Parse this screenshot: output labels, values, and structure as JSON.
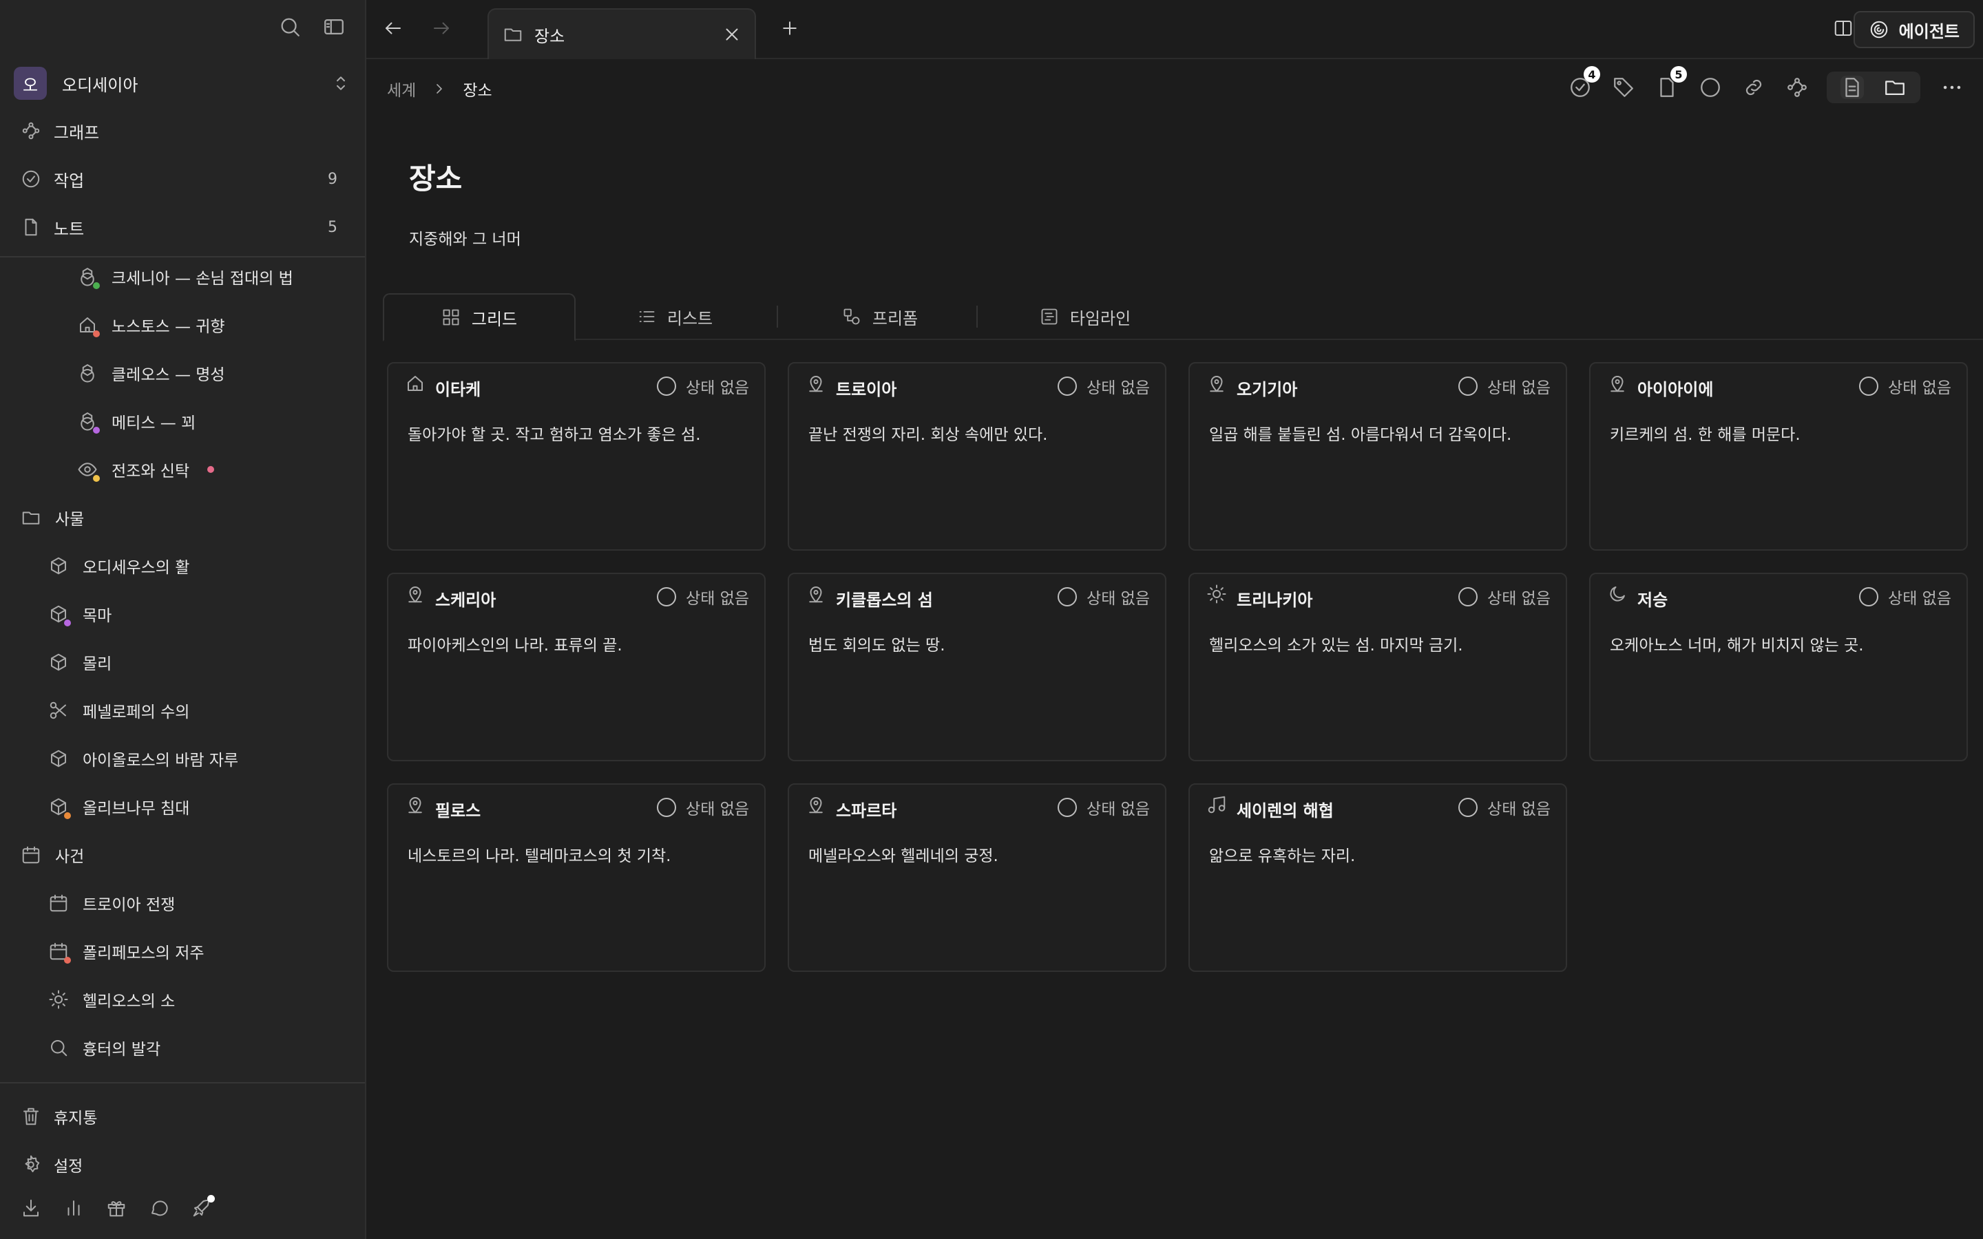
{
  "sidebar": {
    "workspace": {
      "initial": "오",
      "name": "오디세이아"
    },
    "nav": [
      {
        "label": "그래프",
        "icon": "graph-icon",
        "count": ""
      },
      {
        "label": "작업",
        "icon": "task-check-icon",
        "count": "9"
      },
      {
        "label": "노트",
        "icon": "note-icon",
        "count": "5"
      }
    ],
    "tree": [
      {
        "label": "크세니아 — 손님 접대의 법",
        "icon": "globe-icon",
        "dot": "#4caf50"
      },
      {
        "label": "노스토스 — 귀향",
        "icon": "home-icon",
        "dot": "#e66a5a"
      },
      {
        "label": "클레오스 — 명성",
        "icon": "globe-icon",
        "dot": ""
      },
      {
        "label": "메티스 — 꾀",
        "icon": "globe-icon",
        "dot": "#b667e0"
      },
      {
        "label": "전조와 신탁",
        "icon": "eye-icon",
        "dot": "#f0c24a",
        "inline_dot": "#e56b8a"
      },
      {
        "label": "사물",
        "icon": "folder-icon",
        "dot": ""
      },
      {
        "label": "오디세우스의 활",
        "icon": "cube-icon",
        "dot": ""
      },
      {
        "label": "목마",
        "icon": "cube-icon",
        "dot": "#b667e0"
      },
      {
        "label": "몰리",
        "icon": "cube-icon",
        "dot": ""
      },
      {
        "label": "페넬로페의 수의",
        "icon": "scissors-icon",
        "dot": ""
      },
      {
        "label": "아이올로스의 바람 자루",
        "icon": "cube-icon",
        "dot": ""
      },
      {
        "label": "올리브나무 침대",
        "icon": "cube-icon",
        "dot": "#e88a3a"
      },
      {
        "label": "사건",
        "icon": "calendar-icon",
        "dot": ""
      },
      {
        "label": "트로이아 전쟁",
        "icon": "calendar-icon",
        "dot": ""
      },
      {
        "label": "폴리페모스의 저주",
        "icon": "calendar-icon",
        "dot": "#e66a5a"
      },
      {
        "label": "헬리오스의 소",
        "icon": "sun-icon",
        "dot": ""
      },
      {
        "label": "흉터의 발각",
        "icon": "search-icon",
        "dot": ""
      }
    ],
    "trash": "휴지통",
    "settings": "설정"
  },
  "tabs": [
    {
      "label": "장소",
      "icon": "folder-icon"
    }
  ],
  "agent_label": "에이전트",
  "breadcrumb": {
    "parent": "세계",
    "current": "장소"
  },
  "toolbar": {
    "tasks_badge": "4",
    "notes_badge": "5"
  },
  "page": {
    "title": "장소",
    "description": "지중해와 그 너머"
  },
  "view_tabs": [
    {
      "label": "그리드",
      "icon": "grid-icon",
      "active": true
    },
    {
      "label": "리스트",
      "icon": "list-icon",
      "active": false
    },
    {
      "label": "프리폼",
      "icon": "freeform-icon",
      "active": false
    },
    {
      "label": "타임라인",
      "icon": "timeline-icon",
      "active": false
    }
  ],
  "cards": [
    {
      "title": "이타케",
      "icon": "home-icon",
      "status": "상태 없음",
      "desc": "돌아가야 할 곳. 작고 험하고 염소가 좋은 섬."
    },
    {
      "title": "트로이아",
      "icon": "location-pin-icon",
      "status": "상태 없음",
      "desc": "끝난 전쟁의 자리. 회상 속에만 있다."
    },
    {
      "title": "오기기아",
      "icon": "location-pin-icon",
      "status": "상태 없음",
      "desc": "일곱 해를 붙들린 섬. 아름다워서 더 감옥이다."
    },
    {
      "title": "아이아이에",
      "icon": "location-pin-icon",
      "status": "상태 없음",
      "desc": "키르케의 섬. 한 해를 머문다."
    },
    {
      "title": "스케리아",
      "icon": "location-pin-icon",
      "status": "상태 없음",
      "desc": "파이아케스인의 나라. 표류의 끝."
    },
    {
      "title": "키클롭스의 섬",
      "icon": "location-pin-icon",
      "status": "상태 없음",
      "desc": "법도 회의도 없는 땅."
    },
    {
      "title": "트리나키아",
      "icon": "sun-icon",
      "status": "상태 없음",
      "desc": "헬리오스의 소가 있는 섬. 마지막 금기."
    },
    {
      "title": "저승",
      "icon": "moon-icon",
      "status": "상태 없음",
      "desc": "오케아노스 너머, 해가 비치지 않는 곳."
    },
    {
      "title": "필로스",
      "icon": "location-pin-icon",
      "status": "상태 없음",
      "desc": "네스토르의 나라. 텔레마코스의 첫 기착."
    },
    {
      "title": "스파르타",
      "icon": "location-pin-icon",
      "status": "상태 없음",
      "desc": "메넬라오스와 헬레네의 궁정."
    },
    {
      "title": "세이렌의 해협",
      "icon": "music-note-icon",
      "status": "상태 없음",
      "desc": "앎으로 유혹하는 자리."
    }
  ]
}
